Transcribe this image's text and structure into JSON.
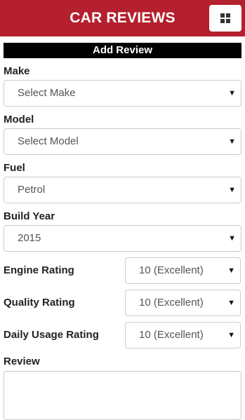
{
  "header": {
    "title": "CAR REVIEWS",
    "menu_icon": "grid-icon",
    "color": "#b4202e"
  },
  "form": {
    "section_title": "Add Review",
    "make": {
      "label": "Make",
      "value": "Select Make"
    },
    "model": {
      "label": "Model",
      "value": "Select Model"
    },
    "fuel": {
      "label": "Fuel",
      "value": "Petrol"
    },
    "build_year": {
      "label": "Build Year",
      "value": "2015"
    },
    "engine_rating": {
      "label": "Engine Rating",
      "value": "10 (Excellent)"
    },
    "quality_rating": {
      "label": "Quality Rating",
      "value": "10 (Excellent)"
    },
    "daily_usage_rating": {
      "label": "Daily Usage Rating",
      "value": "10 (Excellent)"
    },
    "review": {
      "label": "Review",
      "value": ""
    }
  }
}
